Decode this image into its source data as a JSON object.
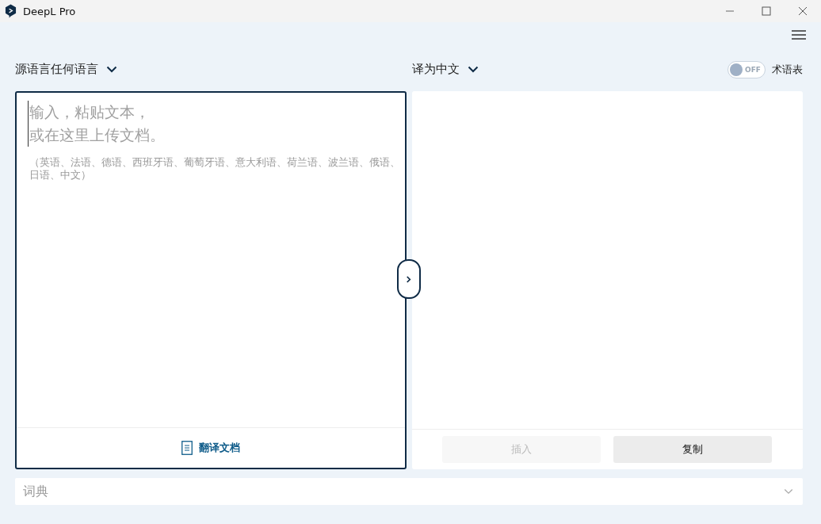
{
  "window": {
    "title": "DeepL Pro"
  },
  "source": {
    "language": "源语言任何语言",
    "placeholder_lines": [
      "输入，粘贴文本，",
      "或在这里上传文档。"
    ],
    "hint": "（英语、法语、德语、西班牙语、葡萄牙语、意大利语、荷兰语、波兰语、俄语、日语、中文）",
    "document_button": "翻译文档"
  },
  "target": {
    "language": "译为中文",
    "glossary": {
      "label": "术语表",
      "on": false,
      "state_text": "OFF"
    },
    "buttons": [
      {
        "label": "插入",
        "disabled": true
      },
      {
        "label": "复制",
        "disabled": false
      }
    ]
  },
  "dictionary": {
    "label": "词典",
    "expanded": false
  }
}
